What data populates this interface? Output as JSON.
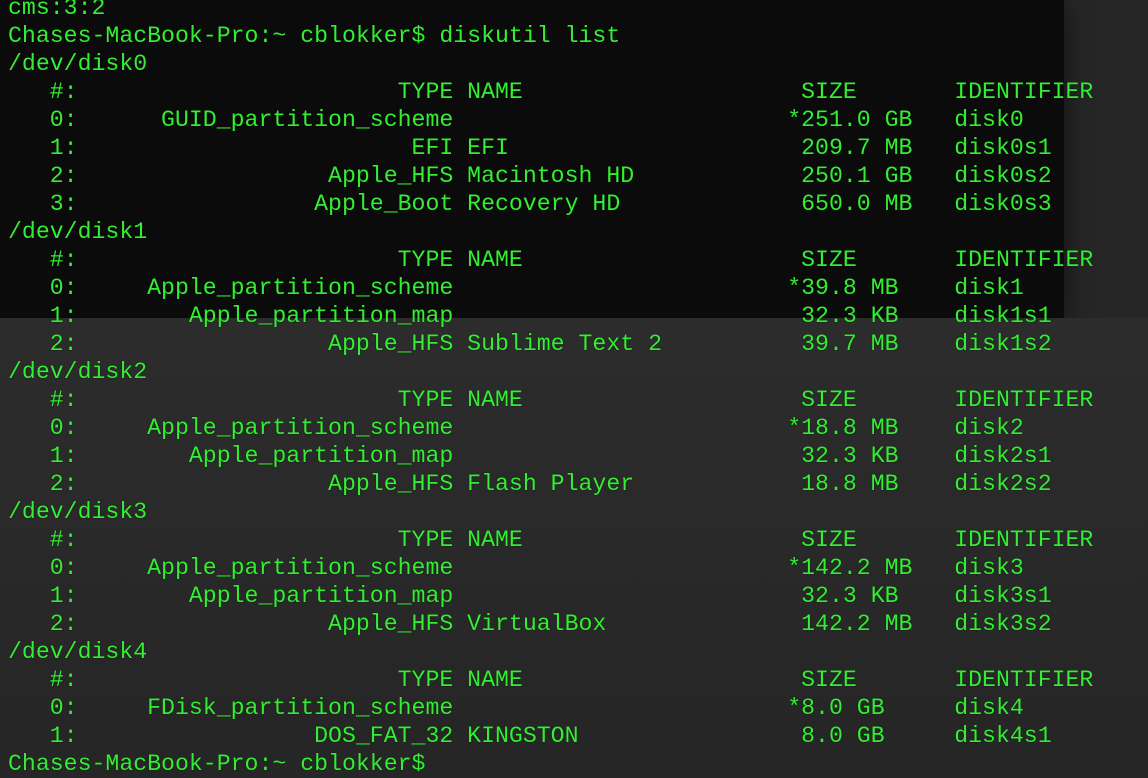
{
  "terminal": {
    "prompt_top_partial": "cms:3:2",
    "command_prompt": "Chases-MacBook-Pro:~ cblokker$ diskutil list",
    "prompt_bottom_partial": "Chases-MacBook-Pro:~ cblokker$",
    "header_row": "   #:                       TYPE NAME                    SIZE       IDENTIFIER",
    "disks": [
      {
        "device": "/dev/disk0",
        "rows": [
          "   0:      GUID_partition_scheme                        *251.0 GB   disk0",
          "   1:                        EFI EFI                     209.7 MB   disk0s1",
          "   2:                  Apple_HFS Macintosh HD            250.1 GB   disk0s2",
          "   3:                 Apple_Boot Recovery HD             650.0 MB   disk0s3"
        ]
      },
      {
        "device": "/dev/disk1",
        "rows": [
          "   0:     Apple_partition_scheme                        *39.8 MB    disk1",
          "   1:        Apple_partition_map                         32.3 KB    disk1s1",
          "   2:                  Apple_HFS Sublime Text 2          39.7 MB    disk1s2"
        ]
      },
      {
        "device": "/dev/disk2",
        "rows": [
          "   0:     Apple_partition_scheme                        *18.8 MB    disk2",
          "   1:        Apple_partition_map                         32.3 KB    disk2s1",
          "   2:                  Apple_HFS Flash Player            18.8 MB    disk2s2"
        ]
      },
      {
        "device": "/dev/disk3",
        "rows": [
          "   0:     Apple_partition_scheme                        *142.2 MB   disk3",
          "   1:        Apple_partition_map                         32.3 KB    disk3s1",
          "   2:                  Apple_HFS VirtualBox              142.2 MB   disk3s2"
        ]
      },
      {
        "device": "/dev/disk4",
        "rows": [
          "   0:     FDisk_partition_scheme                        *8.0 GB     disk4",
          "   1:                 DOS_FAT_32 KINGSTON                8.0 GB     disk4s1"
        ]
      }
    ],
    "text_color": "#33ee33"
  }
}
